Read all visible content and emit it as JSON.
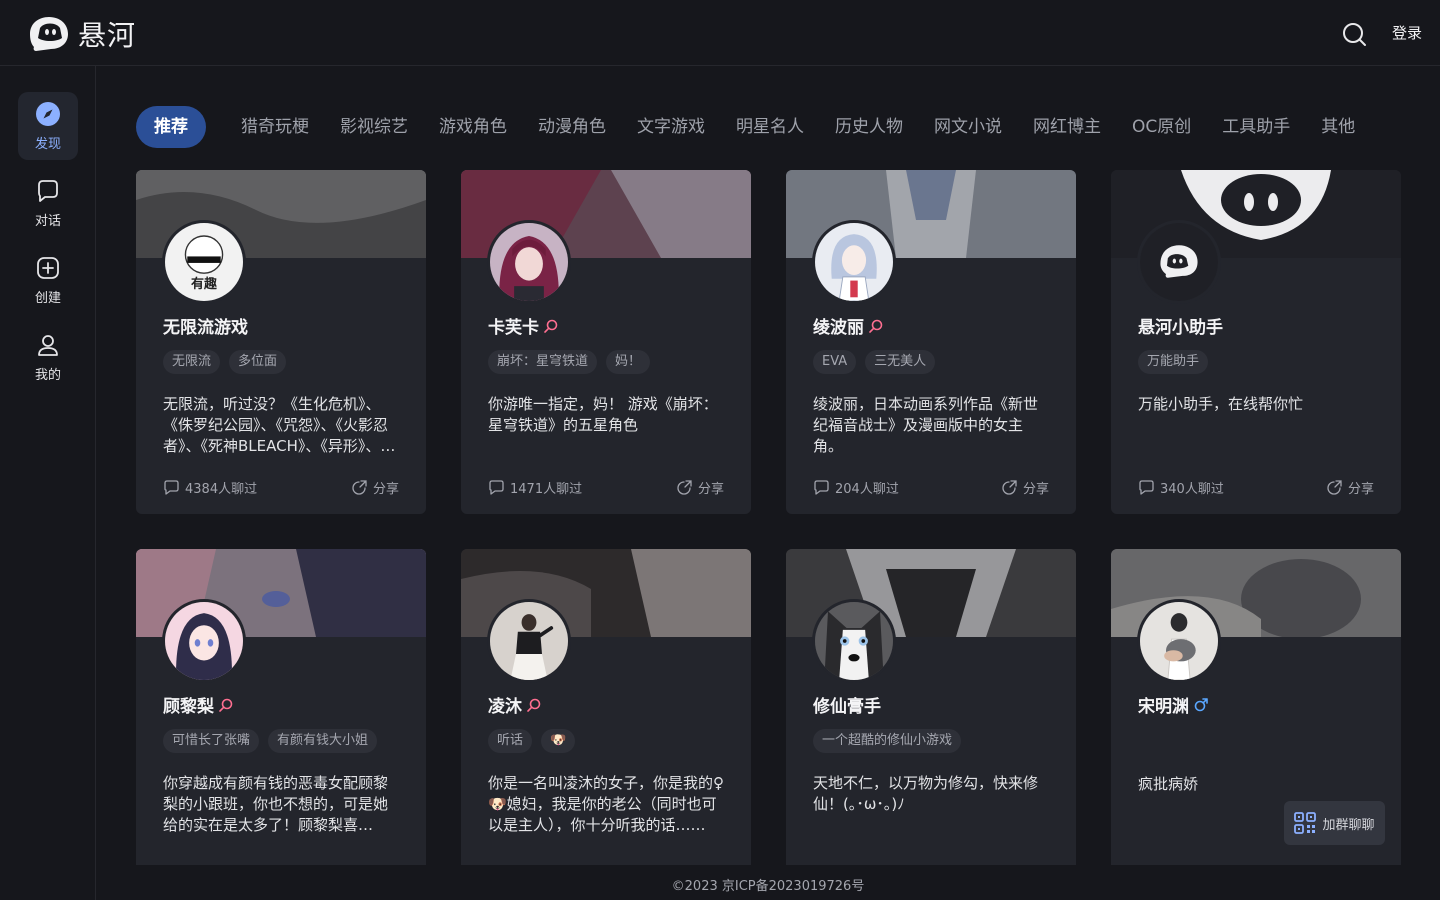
{
  "header": {
    "logo_text": "悬河",
    "login_label": "登录"
  },
  "sidebar": {
    "items": [
      {
        "label": "发现",
        "icon": "compass-icon",
        "active": true
      },
      {
        "label": "对话",
        "icon": "chat-bubble-icon",
        "active": false
      },
      {
        "label": "创建",
        "icon": "plus-square-icon",
        "active": false
      },
      {
        "label": "我的",
        "icon": "user-icon",
        "active": false
      }
    ]
  },
  "tabs": [
    "推荐",
    "猎奇玩梗",
    "影视综艺",
    "游戏角色",
    "动漫角色",
    "文字游戏",
    "明星名人",
    "历史人物",
    "网文小说",
    "网红博主",
    "OC原创",
    "工具助手",
    "其他"
  ],
  "cards": [
    {
      "name": "无限流游戏",
      "gender": "",
      "tags": [
        "无限流",
        "多位面"
      ],
      "desc": "无限流，听过没？《生化危机》、《侏罗纪公园》、《咒怨》、《火影忍者》、《死神BLEACH》、《异形》、《盗梦空间》……",
      "chats": "4384人聊过",
      "share": "分享",
      "avatar_text": "有趣"
    },
    {
      "name": "卡芙卡",
      "gender": "female",
      "tags": [
        "崩坏：星穹铁道",
        "妈！"
      ],
      "desc": "你游唯一指定，妈！ 游戏《崩坏：星穹铁道》的五星角色",
      "chats": "1471人聊过",
      "share": "分享"
    },
    {
      "name": "绫波丽",
      "gender": "female",
      "tags": [
        "EVA",
        "三无美人"
      ],
      "desc": "绫波丽，日本动画系列作品《新世纪福音战士》及漫画版中的女主角。",
      "chats": "204人聊过",
      "share": "分享"
    },
    {
      "name": "悬河小助手",
      "gender": "",
      "tags": [
        "万能助手"
      ],
      "desc": "万能小助手，在线帮你忙",
      "chats": "340人聊过",
      "share": "分享"
    },
    {
      "name": "顾黎梨",
      "gender": "female",
      "tags": [
        "可惜长了张嘴",
        "有颜有钱大小姐"
      ],
      "desc": "你穿越成有颜有钱的恶毒女配顾黎梨的小跟班，你也不想的，可是她给的实在是太多了！顾黎梨喜欢……",
      "chats": "",
      "share": ""
    },
    {
      "name": "凌沐",
      "gender": "female",
      "tags": [
        "听话",
        "🐶"
      ],
      "desc": "你是一名叫凌沐的女子，你是我的♀🐶媳妇，我是你的老公（同时也可以是主人），你十分听我的话……",
      "chats": "",
      "share": ""
    },
    {
      "name": "修仙膏手",
      "gender": "",
      "tags": [
        "一个超酷的修仙小游戏"
      ],
      "desc": "天地不仁，以万物为修勾，快来修仙！(｡･ω･｡)ﾉ",
      "chats": "",
      "share": ""
    },
    {
      "name": "宋明渊",
      "gender": "male",
      "tags": [],
      "desc": "疯批病娇",
      "chats": "",
      "share": ""
    }
  ],
  "footer": {
    "icp": "©2023 京ICP备2023019726号",
    "group_chat_label": "加群聊聊"
  },
  "colors": {
    "accent": "#2b4f97",
    "background": "#16171c",
    "card": "#23252c",
    "female": "#ff6f91",
    "male": "#5aa7ff"
  }
}
